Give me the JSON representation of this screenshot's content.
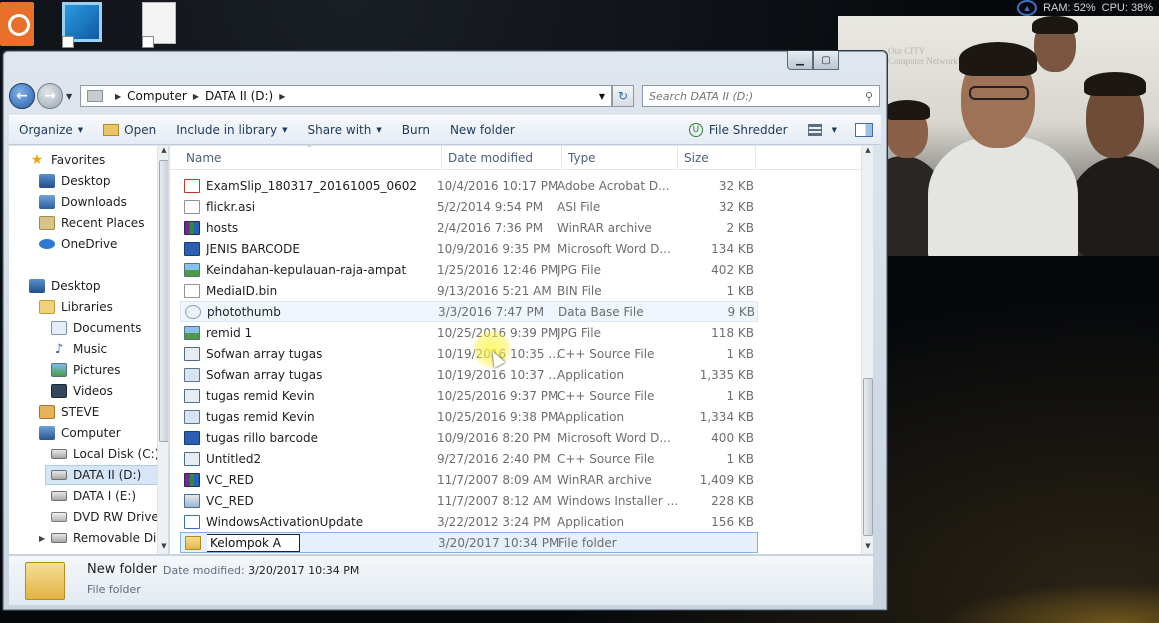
{
  "system_monitor": {
    "ram": "RAM: 52%",
    "cpu": "CPU: 38%"
  },
  "address_bar": {
    "crumbs": [
      "Computer",
      "DATA II (D:)"
    ],
    "search_placeholder": "Search DATA II (D:)"
  },
  "toolbar": {
    "organize": "Organize",
    "open": "Open",
    "include_in_library": "Include in library",
    "share_with": "Share with",
    "burn": "Burn",
    "new_folder": "New folder",
    "file_shredder": "File Shredder"
  },
  "navigation": {
    "favorites": "Favorites",
    "desktop_fav": "Desktop",
    "downloads": "Downloads",
    "recent_places": "Recent Places",
    "onedrive": "OneDrive",
    "desktop": "Desktop",
    "libraries": "Libraries",
    "documents": "Documents",
    "music": "Music",
    "pictures": "Pictures",
    "videos": "Videos",
    "steve": "STEVE",
    "computer": "Computer",
    "local_disk": "Local Disk (C:)",
    "data2": "DATA II (D:)",
    "data1": "DATA I (E:)",
    "dvd": "DVD RW Drive (",
    "removable": "Removable Dis"
  },
  "columns": {
    "name": "Name",
    "date": "Date modified",
    "type": "Type",
    "size": "Size"
  },
  "files": [
    {
      "name": "ExamSlip_180317_20161005_0602",
      "date": "10/4/2016 10:17 PM",
      "type": "Adobe Acrobat D...",
      "size": "32 KB",
      "icon": "pdf-icon"
    },
    {
      "name": "flickr.asi",
      "date": "5/2/2014 9:54 PM",
      "type": "ASI File",
      "size": "32 KB",
      "icon": "asi-file-icon"
    },
    {
      "name": "hosts",
      "date": "2/4/2016 7:36 PM",
      "type": "WinRAR archive",
      "size": "2 KB",
      "icon": "rar-icon"
    },
    {
      "name": "JENIS BARCODE",
      "date": "10/9/2016 9:35 PM",
      "type": "Microsoft Word D...",
      "size": "134 KB",
      "icon": "word-icon"
    },
    {
      "name": "Keindahan-kepulauan-raja-ampat",
      "date": "1/25/2016 12:46 PM",
      "type": "JPG File",
      "size": "402 KB",
      "icon": "image-icon"
    },
    {
      "name": "MediaID.bin",
      "date": "9/13/2016 5:21 AM",
      "type": "BIN File",
      "size": "1 KB",
      "icon": "bin-file-icon"
    },
    {
      "name": "photothumb",
      "date": "3/3/2016 7:47 PM",
      "type": "Data Base File",
      "size": "9 KB",
      "icon": "database-icon"
    },
    {
      "name": "remid 1",
      "date": "10/25/2016 9:39 PM",
      "type": "JPG File",
      "size": "118 KB",
      "icon": "image-icon"
    },
    {
      "name": "Sofwan array tugas",
      "date": "10/19/2016 10:35 ...",
      "type": "C++ Source File",
      "size": "1 KB",
      "icon": "cpp-icon"
    },
    {
      "name": "Sofwan array tugas",
      "date": "10/19/2016 10:37 ...",
      "type": "Application",
      "size": "1,335 KB",
      "icon": "application-icon"
    },
    {
      "name": "tugas remid Kevin",
      "date": "10/25/2016 9:37 PM",
      "type": "C++ Source File",
      "size": "1 KB",
      "icon": "cpp-icon"
    },
    {
      "name": "tugas remid Kevin",
      "date": "10/25/2016 9:38 PM",
      "type": "Application",
      "size": "1,334 KB",
      "icon": "application-icon"
    },
    {
      "name": "tugas rillo barcode",
      "date": "10/9/2016 8:20 PM",
      "type": "Microsoft Word D...",
      "size": "400 KB",
      "icon": "word-icon"
    },
    {
      "name": "Untitled2",
      "date": "9/27/2016 2:40 PM",
      "type": "C++ Source File",
      "size": "1 KB",
      "icon": "cpp-icon"
    },
    {
      "name": "VC_RED",
      "date": "11/7/2007 8:09 AM",
      "type": "WinRAR archive",
      "size": "1,409 KB",
      "icon": "rar-icon"
    },
    {
      "name": "VC_RED",
      "date": "11/7/2007 8:12 AM",
      "type": "Windows Installer ...",
      "size": "228 KB",
      "icon": "installer-icon"
    },
    {
      "name": "WindowsActivationUpdate",
      "date": "3/22/2012 3:24 PM",
      "type": "Application",
      "size": "156 KB",
      "icon": "update-icon"
    },
    {
      "name": "Kelompok A",
      "date": "3/20/2017 10:34 PM",
      "type": "File folder",
      "size": "",
      "icon": "folder-icon"
    }
  ],
  "details": {
    "name": "New folder",
    "modified_label": "Date modified:",
    "modified_value": "3/20/2017 10:34 PM",
    "type": "File folder"
  },
  "webcam_wall_text": [
    "Our CITY",
    "Computer Network"
  ]
}
